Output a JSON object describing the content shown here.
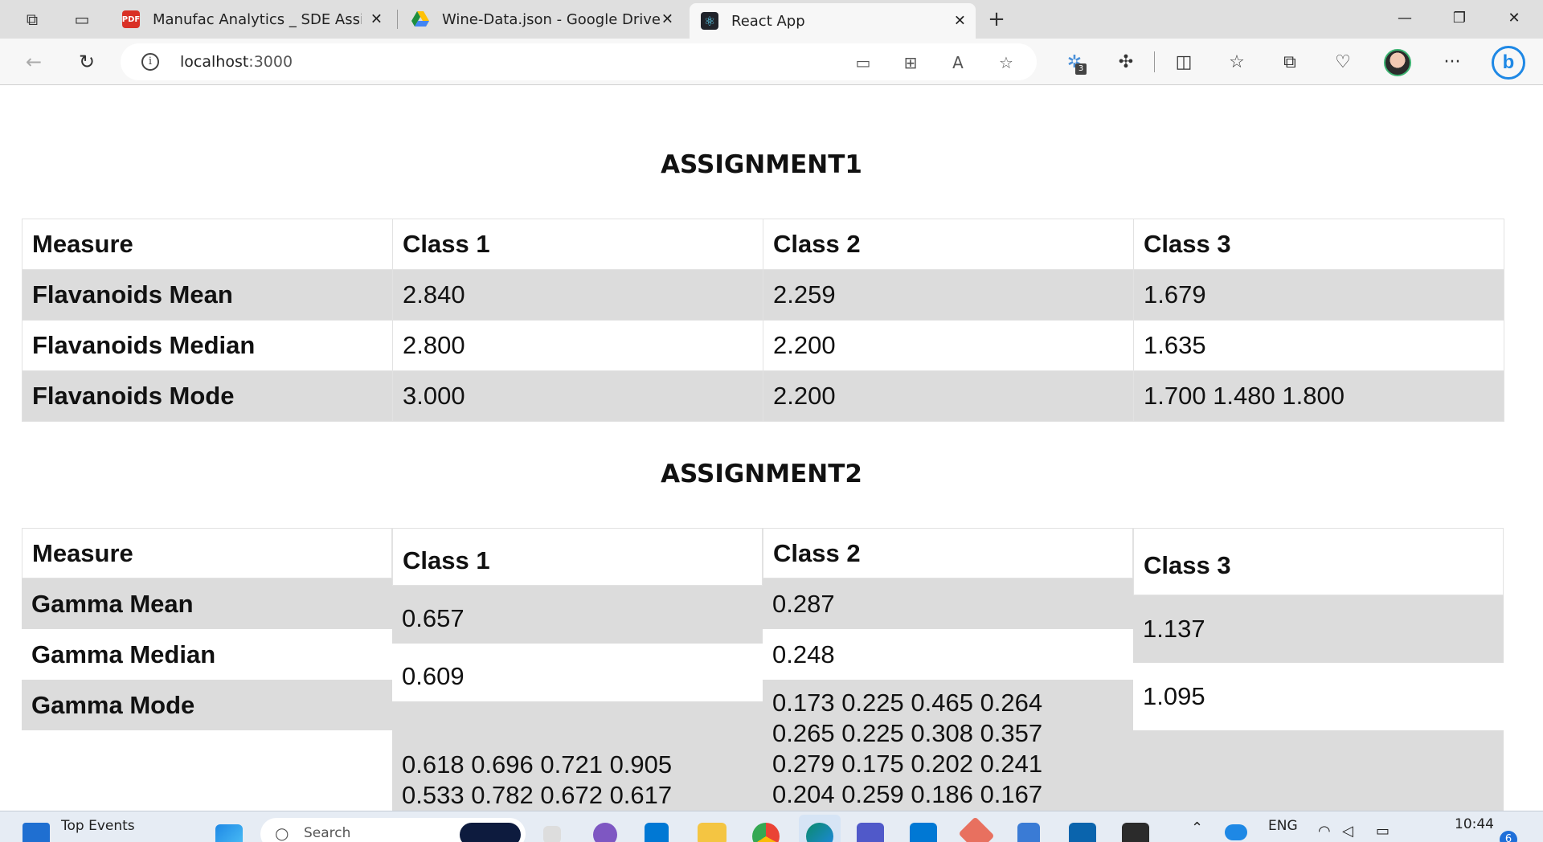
{
  "browser": {
    "tabs": [
      {
        "title": "Manufac Analytics _ SDE Assignm",
        "favicon": "pdf-icon",
        "active": false
      },
      {
        "title": "Wine-Data.json - Google Drive",
        "favicon": "google-drive-icon",
        "active": false
      },
      {
        "title": "React App",
        "favicon": "react-icon",
        "active": true
      }
    ],
    "url_host": "localhost",
    "url_port": ":3000",
    "extension_badge": "3"
  },
  "assignment1": {
    "heading": "ASSIGNMENT1",
    "headers": [
      "Measure",
      "Class 1",
      "Class 2",
      "Class 3"
    ],
    "rows": [
      {
        "label": "Flavanoids Mean",
        "c1": "2.840",
        "c2": "2.259",
        "c3": "1.679"
      },
      {
        "label": "Flavanoids Median",
        "c1": "2.800",
        "c2": "2.200",
        "c3": "1.635"
      },
      {
        "label": "Flavanoids Mode",
        "c1": "3.000",
        "c2": "2.200",
        "c3": "1.700 1.480 1.800"
      }
    ]
  },
  "assignment2": {
    "heading": "ASSIGNMENT2",
    "headers": [
      "Measure",
      "Class 1",
      "Class 2",
      "Class 3"
    ],
    "labels": [
      "Gamma Mean",
      "Gamma Median",
      "Gamma Mode"
    ],
    "class1": {
      "mean": "0.657",
      "median": "0.609",
      "mode_line1": "0.618 0.696 0.721 0.905",
      "mode_line2": "0.533 0.782 0.672 0.617"
    },
    "class2": {
      "mean": "0.287",
      "median": "0.248",
      "mode_line1": "0.173 0.225 0.465 0.264",
      "mode_line2": "0.265 0.225 0.308 0.357",
      "mode_line3": "0.279 0.175 0.202 0.241",
      "mode_line4": "0.204 0.259 0.186 0.167"
    },
    "class3": {
      "mean": "1.137",
      "median": "1.095"
    }
  },
  "taskbar": {
    "widget_label": "Top Events",
    "search_placeholder": "Search",
    "language": "ENG",
    "time": "10:44",
    "notification_count": "6"
  },
  "colors": {
    "stripe": "#dcdcdc",
    "chrome": "#dfdfdf",
    "accent": "#1e88e5"
  }
}
